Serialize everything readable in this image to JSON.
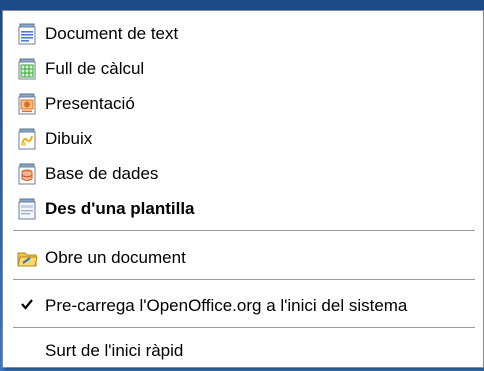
{
  "menu": {
    "items": [
      {
        "label": "Document de text",
        "icon": "writer-document-icon",
        "bold": false
      },
      {
        "label": "Full de càlcul",
        "icon": "calc-spreadsheet-icon",
        "bold": false
      },
      {
        "label": "Presentació",
        "icon": "impress-presentation-icon",
        "bold": false
      },
      {
        "label": "Dibuix",
        "icon": "draw-drawing-icon",
        "bold": false
      },
      {
        "label": "Base de dades",
        "icon": "base-database-icon",
        "bold": false
      },
      {
        "label": "Des d'una plantilla",
        "icon": "template-icon",
        "bold": true
      },
      {
        "label": "Obre un document",
        "icon": "open-folder-icon",
        "bold": false
      },
      {
        "label": "Pre-carrega l'OpenOffice.org a l'inici del sistema",
        "icon": "checkmark-icon",
        "checked": true
      },
      {
        "label": "Surt de l'inici ràpid",
        "icon": "",
        "bold": false
      }
    ]
  },
  "colors": {
    "menu_background": "#ffffff",
    "writer": "#4a7fd0",
    "calc": "#3aa33a",
    "impress": "#e0701c",
    "draw": "#e8b020",
    "base": "#c85a2a"
  }
}
